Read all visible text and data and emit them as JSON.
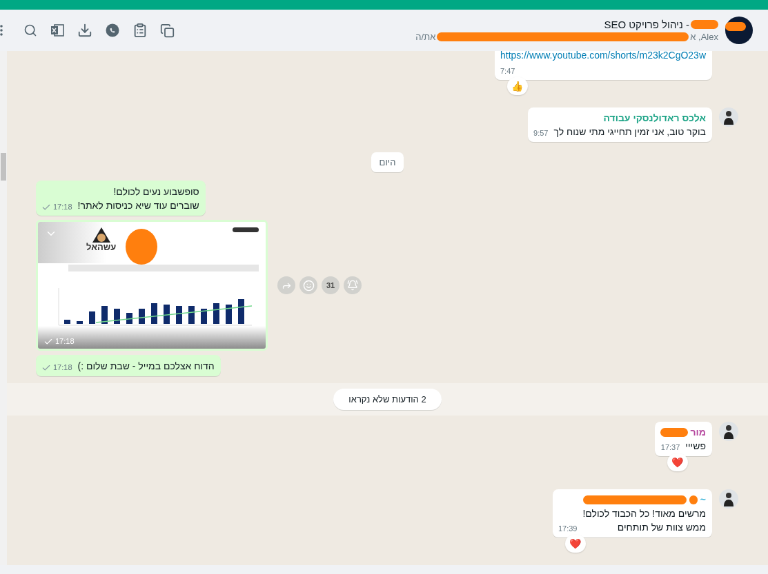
{
  "header": {
    "title": "- ניהול פרויקט SEO",
    "subtitle_start": "Alex, א",
    "subtitle_end": "את/ה"
  },
  "messages": [
    {
      "kind": "incoming",
      "link": "https://www.youtube.com/shorts/m23k2CgO23w",
      "time": "7:47",
      "reaction": "👍",
      "cut": true
    },
    {
      "kind": "incoming",
      "sender": "אלכס ראדולנסקי עבודה",
      "color": "#1fa588",
      "lines": [
        "בוקר טוב, אני זמין תחייגי מתי שנוח לך"
      ],
      "time": "9:57"
    },
    {
      "kind": "date",
      "text": "היום"
    },
    {
      "kind": "outgoing",
      "lines": [
        "סופשבוע נעים לכולם!",
        "שוברים עוד שיא כניסות לאתר!"
      ],
      "time": "17:18"
    },
    {
      "kind": "image",
      "logo": "עשהאל",
      "time": "17:18",
      "calendar_day": "31"
    },
    {
      "kind": "outgoing",
      "lines": [
        "הדוח אצלכם במייל - שבת שלום :)"
      ],
      "time": "17:18"
    },
    {
      "kind": "unread",
      "text": "2 הודעות שלא נקראו"
    },
    {
      "kind": "incoming",
      "sender": "מור",
      "color": "#b5479e",
      "redacted": true,
      "lines": [
        "פשייי"
      ],
      "time": "17:37",
      "reaction": "❤️"
    },
    {
      "kind": "incoming",
      "sender": "~",
      "color": "#3ab4d8",
      "redacted": true,
      "lines": [
        "מרשים מאוד! כל הכבוד לכולם!",
        "ממש צוות של תותחים"
      ],
      "time": "17:39",
      "reaction": "❤️"
    }
  ]
}
